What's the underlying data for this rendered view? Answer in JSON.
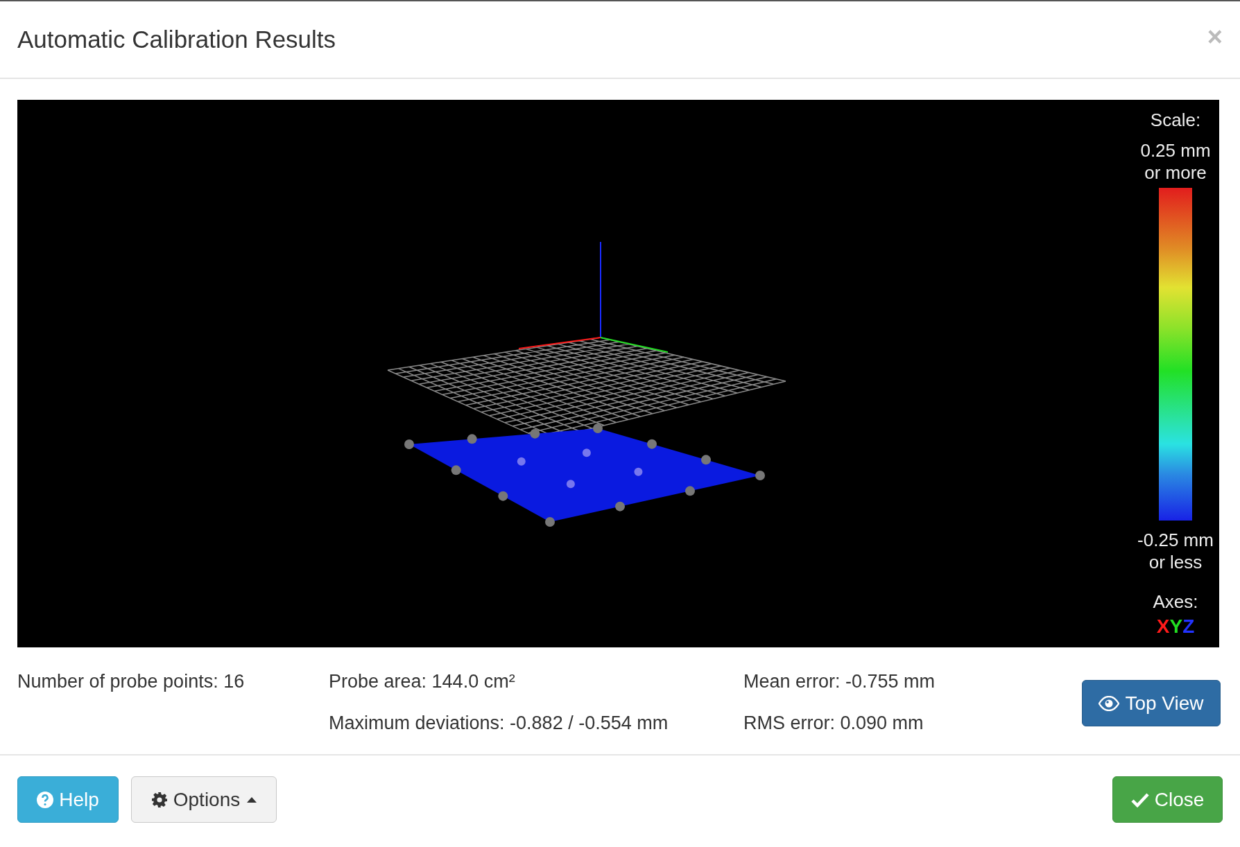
{
  "dialog": {
    "title": "Automatic Calibration Results",
    "close_symbol": "×"
  },
  "viewer": {
    "legend": {
      "title": "Scale:",
      "max_label": "0.25 mm",
      "max_sub": "or more",
      "min_label": "-0.25 mm",
      "min_sub": "or less",
      "axes_title": "Axes:",
      "axes": [
        {
          "label": "X",
          "color": "#ff1a1a"
        },
        {
          "label": "Y",
          "color": "#22dd22"
        },
        {
          "label": "Z",
          "color": "#2233ff"
        }
      ]
    }
  },
  "stats": [
    [
      "Number of probe points: 16"
    ],
    [
      "Probe area: 144.0 cm²",
      "Maximum deviations: -0.882 / -0.554 mm"
    ],
    [
      "Mean error: -0.755 mm",
      "RMS error: 0.090 mm"
    ]
  ],
  "top_view_button": {
    "label": "Top View"
  },
  "footer": {
    "buttons": [
      {
        "label": "Help",
        "kind": "help"
      },
      {
        "label": "Options",
        "kind": "options"
      },
      {
        "label": "Close",
        "kind": "close"
      }
    ]
  }
}
